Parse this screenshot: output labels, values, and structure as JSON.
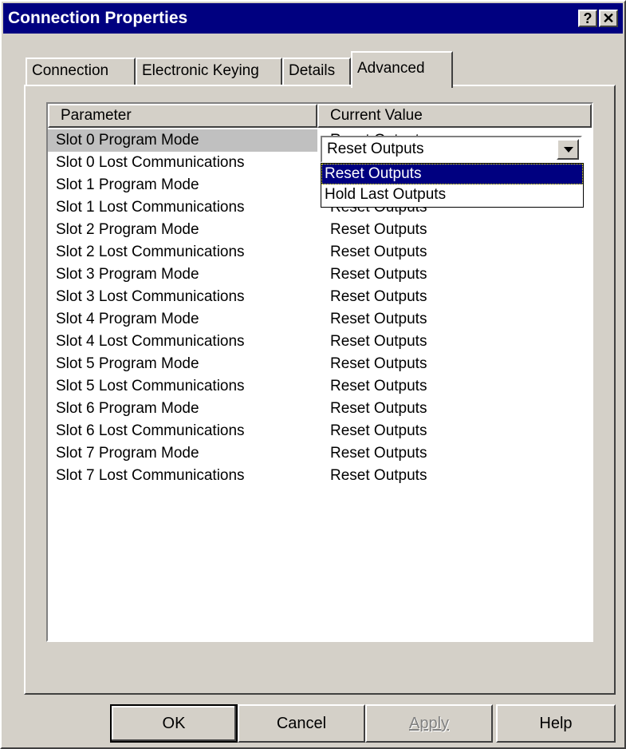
{
  "window": {
    "title": "Connection Properties",
    "help_glyph": "?",
    "close_glyph": "✕"
  },
  "tabs": [
    {
      "label": "Connection"
    },
    {
      "label": "Electronic Keying"
    },
    {
      "label": "Details"
    },
    {
      "label": "Advanced"
    }
  ],
  "grid": {
    "columns": {
      "parameter": "Parameter",
      "value": "Current Value"
    },
    "rows": [
      {
        "parameter": "Slot 0 Program Mode",
        "value": "Reset Outputs"
      },
      {
        "parameter": "Slot 0 Lost Communications",
        "value": ""
      },
      {
        "parameter": "Slot 1 Program Mode",
        "value": ""
      },
      {
        "parameter": "Slot 1 Lost Communications",
        "value": "Reset Outputs"
      },
      {
        "parameter": "Slot 2 Program Mode",
        "value": "Reset Outputs"
      },
      {
        "parameter": "Slot 2 Lost Communications",
        "value": "Reset Outputs"
      },
      {
        "parameter": "Slot 3 Program Mode",
        "value": "Reset Outputs"
      },
      {
        "parameter": "Slot 3 Lost Communications",
        "value": "Reset Outputs"
      },
      {
        "parameter": "Slot 4 Program Mode",
        "value": "Reset Outputs"
      },
      {
        "parameter": "Slot 4 Lost Communications",
        "value": "Reset Outputs"
      },
      {
        "parameter": "Slot 5 Program Mode",
        "value": "Reset Outputs"
      },
      {
        "parameter": "Slot 5 Lost Communications",
        "value": "Reset Outputs"
      },
      {
        "parameter": "Slot 6 Program Mode",
        "value": "Reset Outputs"
      },
      {
        "parameter": "Slot 6 Lost Communications",
        "value": "Reset Outputs"
      },
      {
        "parameter": "Slot 7 Program Mode",
        "value": "Reset Outputs"
      },
      {
        "parameter": "Slot 7 Lost Communications",
        "value": "Reset Outputs"
      }
    ]
  },
  "combo": {
    "selected": "Reset Outputs",
    "options": [
      "Reset Outputs",
      "Hold Last Outputs"
    ]
  },
  "buttons": {
    "ok": "OK",
    "cancel": "Cancel",
    "apply": "Apply",
    "help": "Help"
  }
}
